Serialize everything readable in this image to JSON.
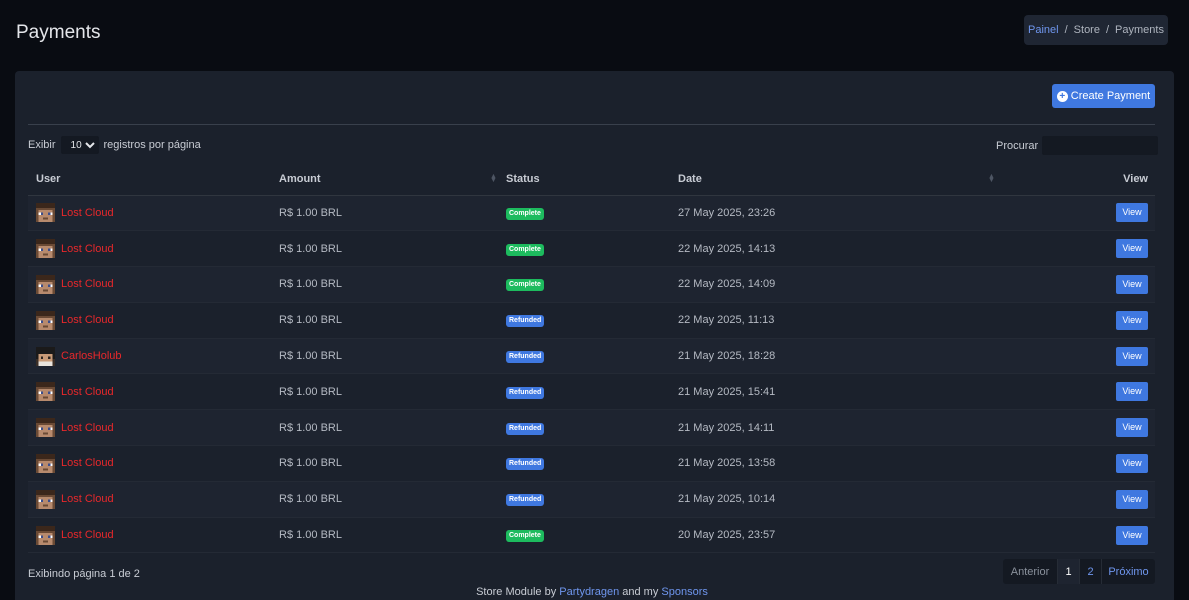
{
  "page": {
    "title": "Payments"
  },
  "breadcrumb": {
    "items": [
      "Painel",
      "Store",
      "Payments"
    ]
  },
  "toolbar": {
    "create_label": "Create Payment"
  },
  "length": {
    "prefix": "Exibir",
    "value": "10",
    "suffix": "registros por página"
  },
  "search": {
    "label": "Procurar",
    "value": ""
  },
  "table": {
    "headers": {
      "user": "User",
      "amount": "Amount",
      "status": "Status",
      "date": "Date",
      "view": "View"
    },
    "rows": [
      {
        "user": "Lost Cloud",
        "avatar": "steve",
        "amount": "R$ 1.00 BRL",
        "status": "Complete",
        "date": "27 May 2025, 23:26",
        "action": "View"
      },
      {
        "user": "Lost Cloud",
        "avatar": "steve",
        "amount": "R$ 1.00 BRL",
        "status": "Complete",
        "date": "22 May 2025, 14:13",
        "action": "View"
      },
      {
        "user": "Lost Cloud",
        "avatar": "steve",
        "amount": "R$ 1.00 BRL",
        "status": "Complete",
        "date": "22 May 2025, 14:09",
        "action": "View"
      },
      {
        "user": "Lost Cloud",
        "avatar": "steve",
        "amount": "R$ 1.00 BRL",
        "status": "Refunded",
        "date": "22 May 2025, 11:13",
        "action": "View"
      },
      {
        "user": "CarlosHolub",
        "avatar": "carlos",
        "amount": "R$ 1.00 BRL",
        "status": "Refunded",
        "date": "21 May 2025, 18:28",
        "action": "View"
      },
      {
        "user": "Lost Cloud",
        "avatar": "steve",
        "amount": "R$ 1.00 BRL",
        "status": "Refunded",
        "date": "21 May 2025, 15:41",
        "action": "View"
      },
      {
        "user": "Lost Cloud",
        "avatar": "steve",
        "amount": "R$ 1.00 BRL",
        "status": "Refunded",
        "date": "21 May 2025, 14:11",
        "action": "View"
      },
      {
        "user": "Lost Cloud",
        "avatar": "steve",
        "amount": "R$ 1.00 BRL",
        "status": "Refunded",
        "date": "21 May 2025, 13:58",
        "action": "View"
      },
      {
        "user": "Lost Cloud",
        "avatar": "steve",
        "amount": "R$ 1.00 BRL",
        "status": "Refunded",
        "date": "21 May 2025, 10:14",
        "action": "View"
      },
      {
        "user": "Lost Cloud",
        "avatar": "steve",
        "amount": "R$ 1.00 BRL",
        "status": "Complete",
        "date": "20 May 2025, 23:57",
        "action": "View"
      }
    ]
  },
  "status_colors": {
    "Complete": "#1dbb5e",
    "Refunded": "#3f78e0"
  },
  "colors": {
    "accent": "#3f78e0",
    "username": "#e8282b",
    "link": "#6f96ee"
  },
  "pagination": {
    "info": "Exibindo página 1 de 2",
    "prev": "Anterior",
    "pages": [
      "1",
      "2"
    ],
    "next": "Próximo"
  },
  "footer": {
    "prefix": "Store Module by",
    "author": "Partydragen",
    "middle": "and my",
    "sponsors": "Sponsors"
  }
}
